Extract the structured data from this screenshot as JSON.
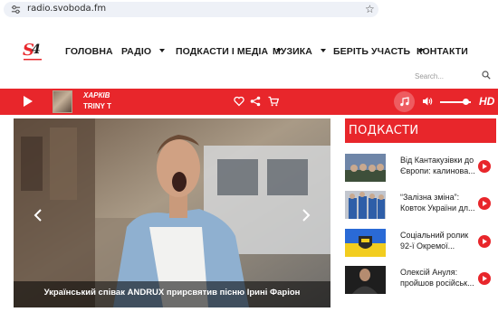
{
  "browser": {
    "url": "radio.svoboda.fm",
    "site_settings_icon": "tune-icon",
    "bookmark_icon": "star-icon"
  },
  "header": {
    "logo_icon": "svoboda-logo",
    "nav": [
      {
        "label": "ГОЛОВНА",
        "has_dropdown": false
      },
      {
        "label": "РАДІО",
        "has_dropdown": true
      },
      {
        "label": "ПОДКАСТИ І МЕДІА",
        "has_dropdown": true
      },
      {
        "label": "МУЗИКА",
        "has_dropdown": true
      },
      {
        "label": "БЕРІТЬ УЧАСТЬ",
        "has_dropdown": true
      },
      {
        "label": "КОНТАКТИ",
        "has_dropdown": false
      }
    ],
    "search_placeholder": "Search..."
  },
  "player": {
    "city": "ХАРКІВ",
    "track": "TRINY T",
    "quality": "HD",
    "volume_level": 0.78,
    "accent_color": "#e8262b",
    "icons": [
      "play-icon",
      "heart-icon",
      "share-icon",
      "cart-icon",
      "music-note-icon",
      "volume-icon"
    ]
  },
  "hero": {
    "caption": "Український співак ANDRUX прирсвятив пісню Ірині Фаріон"
  },
  "podcasts": {
    "title": "ПОДКАСТИ",
    "items": [
      {
        "line1": "Від Кантакузівки до",
        "line2": "Європи: калинова..."
      },
      {
        "line1": "“Залізна зміна”:",
        "line2": "Ковток України дл..."
      },
      {
        "line1": "Соціальний ролик",
        "line2": "92-ї Окремої..."
      },
      {
        "line1": "Олексій Ануля:",
        "line2": "пройшов російськ..."
      }
    ]
  }
}
